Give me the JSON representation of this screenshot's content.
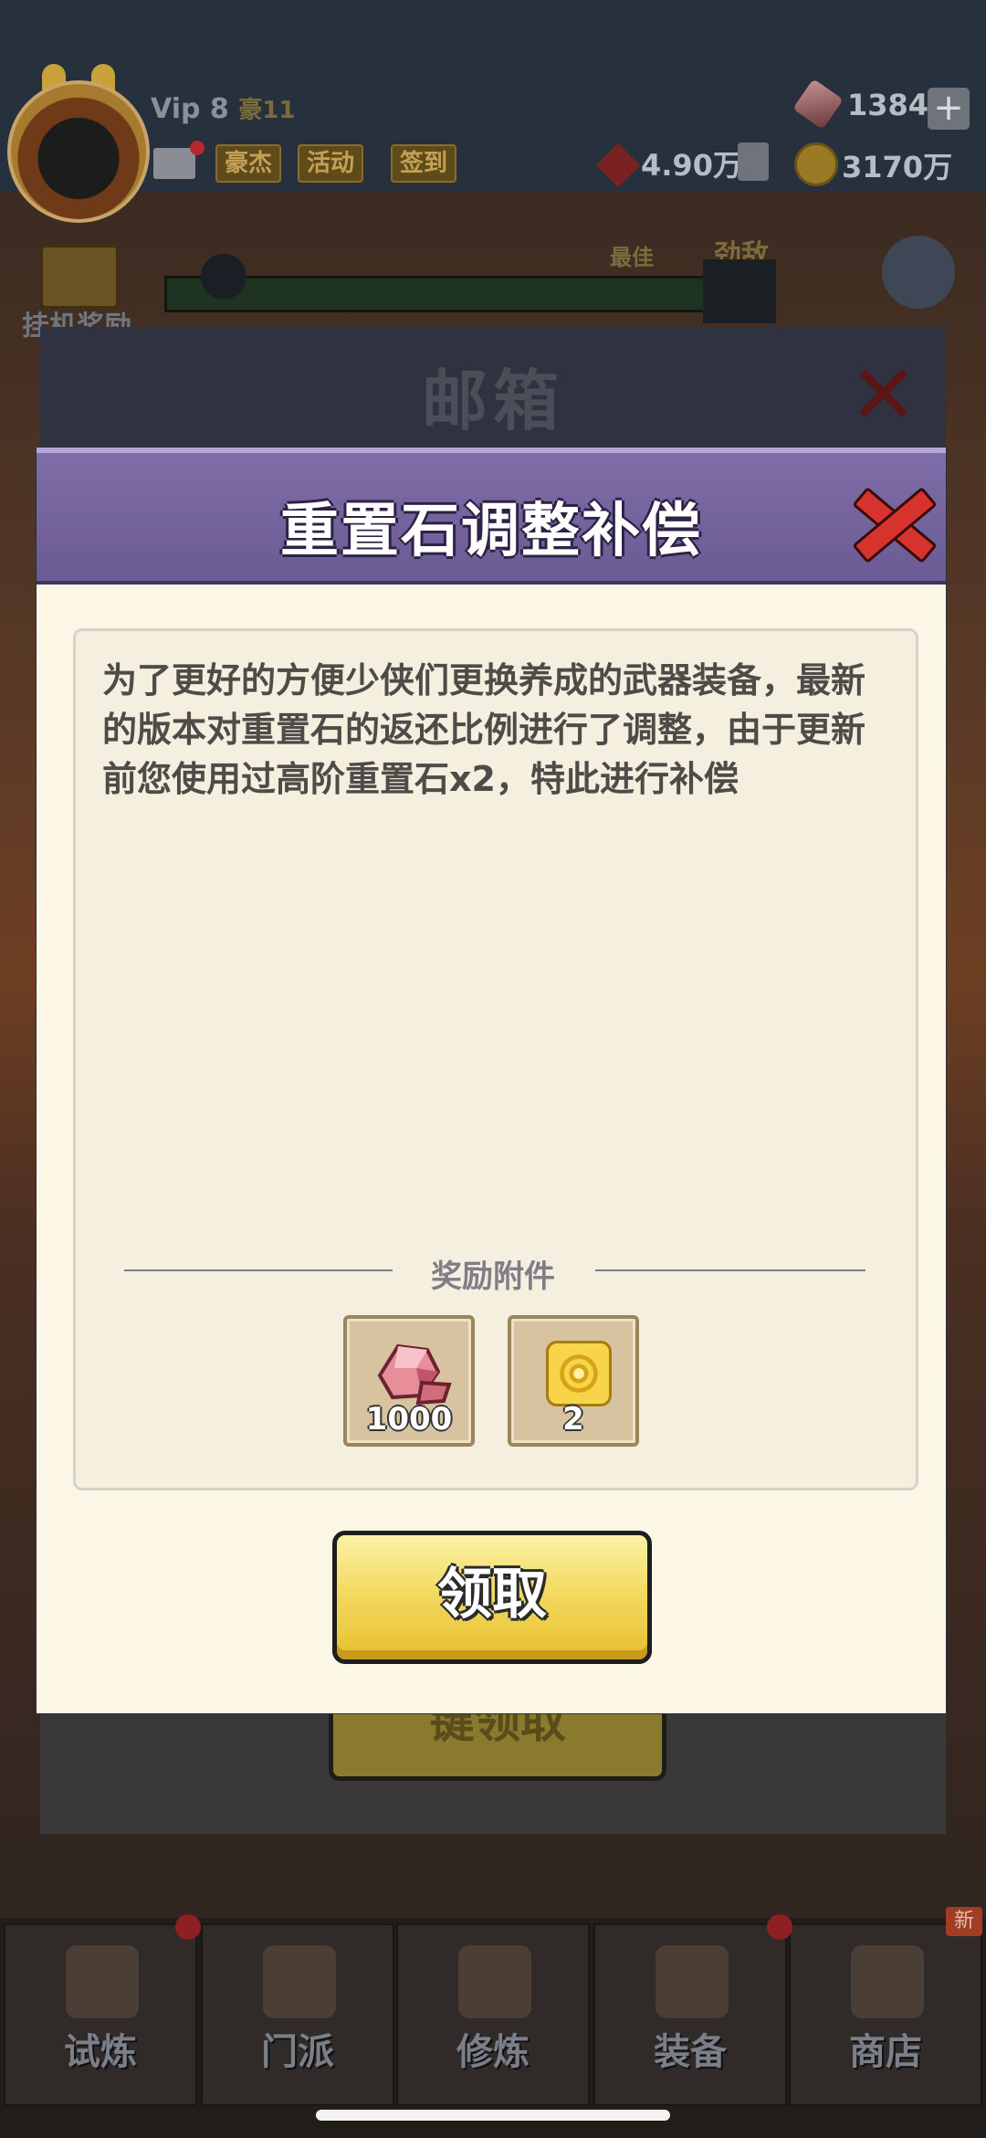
{
  "hud": {
    "vip": "Vip 8",
    "rank": "豪11",
    "buttons": [
      "豪杰",
      "活动",
      "签到"
    ],
    "power": "4.90万",
    "gems": "1384",
    "coins": "3170万",
    "plus": "+",
    "best_label": "最佳",
    "enemy_label": "劲敌",
    "idle_label": "挂机奖励"
  },
  "back_modal": {
    "title": "邮箱",
    "button_label": "键领取"
  },
  "mail": {
    "title": "重置石调整补偿",
    "body": "为了更好的方便少侠们更换养成的武器装备，最新的版本对重置石的返还比例进行了调整，由于更新前您使用过高阶重置石x2，特此进行补偿",
    "attachments_label": "奖励附件",
    "attachments": [
      {
        "icon": "reset-stone-icon",
        "count": "1000"
      },
      {
        "icon": "gold-scroll-icon",
        "count": "2"
      }
    ],
    "claim_label": "领取"
  },
  "nav": {
    "items": [
      "试炼",
      "门派",
      "修炼",
      "装备",
      "商店"
    ],
    "new_badge": "新"
  },
  "colors": {
    "header_purple": "#6b5b95",
    "close_red": "#d6332f",
    "claim_yellow": "#f3da62",
    "panel_cream": "#fcf6e7"
  }
}
